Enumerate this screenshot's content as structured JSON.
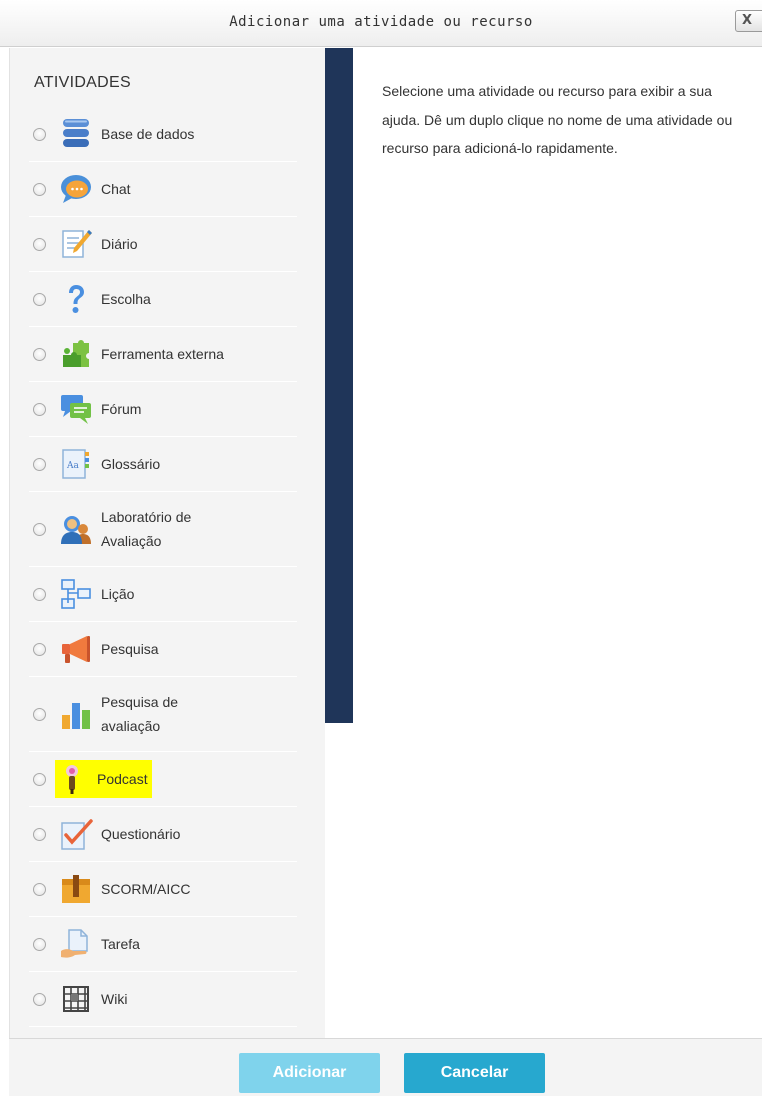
{
  "dialog": {
    "title": "Adicionar uma atividade ou recurso",
    "close_label": "X"
  },
  "activities": {
    "heading": "ATIVIDADES",
    "items": [
      {
        "label": "Base de dados",
        "icon": "database-icon"
      },
      {
        "label": "Chat",
        "icon": "chat-icon"
      },
      {
        "label": "Diário",
        "icon": "journal-icon"
      },
      {
        "label": "Escolha",
        "icon": "question-icon"
      },
      {
        "label": "Ferramenta externa",
        "icon": "puzzle-icon"
      },
      {
        "label": "Fórum",
        "icon": "forum-icon"
      },
      {
        "label": "Glossário",
        "icon": "glossary-icon"
      },
      {
        "label_line1": "Laboratório de",
        "label_line2": "Avaliação",
        "icon": "workshop-icon"
      },
      {
        "label": "Lição",
        "icon": "lesson-icon"
      },
      {
        "label": "Pesquisa",
        "icon": "megaphone-icon"
      },
      {
        "label_line1": "Pesquisa de",
        "label_line2": "avaliação",
        "icon": "bar-chart-icon"
      },
      {
        "label": "Podcast",
        "icon": "microphone-icon",
        "highlight": "#ffff00"
      },
      {
        "label": "Questionário",
        "icon": "quiz-icon"
      },
      {
        "label": "SCORM/AICC",
        "icon": "package-icon"
      },
      {
        "label": "Tarefa",
        "icon": "assignment-icon"
      },
      {
        "label": "Wiki",
        "icon": "wiki-icon"
      }
    ]
  },
  "help": {
    "text": "Selecione uma atividade ou recurso para exibir a sua ajuda. Dê um duplo clique no nome de uma atividade ou recurso para adicioná-lo rapidamente."
  },
  "footer": {
    "add_label": "Adicionar",
    "cancel_label": "Cancelar"
  },
  "colors": {
    "separator": "#1f3559",
    "add_button": "#7fd3ec",
    "cancel_button": "#27a8cf",
    "highlight": "#ffff00"
  }
}
